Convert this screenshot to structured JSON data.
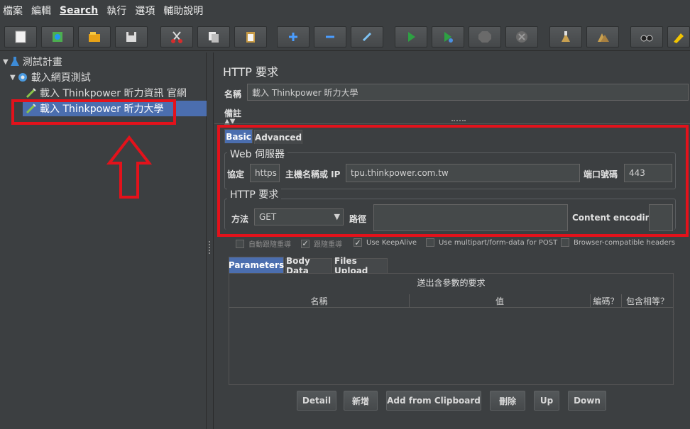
{
  "menu": [
    "檔案",
    "編輯",
    "Search",
    "執行",
    "選項",
    "輔助說明"
  ],
  "toolbar_icons": [
    "new-icon",
    "templates-icon",
    "open-icon",
    "save-icon",
    "cut-icon",
    "copy-icon",
    "paste-icon",
    "expand-icon",
    "collapse-icon",
    "toggle-icon",
    "start-icon",
    "start-no-pause-icon",
    "stop-icon",
    "shutdown-icon",
    "clear-icon",
    "clear-all-icon",
    "search-icon",
    "reset-search-icon"
  ],
  "tree": {
    "plan": "測試計畫",
    "threadgroup": "載入網頁測試",
    "item1": "載入 Thinkpower 昕力資訊 官網",
    "item2": "載入 Thinkpower 昕力大學"
  },
  "panel": {
    "title": "HTTP 要求",
    "name_label": "名稱",
    "name_value": "載入 Thinkpower 昕力大學",
    "comment_label": "備註"
  },
  "tabs": [
    "Basic",
    "Advanced"
  ],
  "web_server": {
    "title": "Web 伺服器",
    "protocol_label": "協定",
    "protocol_value": "https",
    "host_label": "主機名稱或 IP",
    "host_value": "tpu.thinkpower.com.tw",
    "port_label": "端口號碼",
    "port_value": "443"
  },
  "http_request": {
    "title": "HTTP 要求",
    "method_label": "方法",
    "method_value": "GET",
    "path_label": "路徑",
    "path_value": "",
    "encoding_label": "Content encoding:"
  },
  "checkboxes": [
    {
      "label": "自動跟隨重導",
      "checked": false
    },
    {
      "label": "跟隨重導",
      "checked": true
    },
    {
      "label": "Use KeepAlive",
      "checked": true
    },
    {
      "label": "Use multipart/form-data for POST",
      "checked": false
    },
    {
      "label": "Browser-compatible headers",
      "checked": false
    }
  ],
  "param_tabs": [
    "Parameters",
    "Body Data",
    "Files Upload"
  ],
  "table": {
    "caption": "送出含參數的要求",
    "columns": [
      "名稱",
      "值",
      "編碼？",
      "包含相等？"
    ]
  },
  "buttons": [
    "Detail",
    "新增",
    "Add from Clipboard",
    "刪除",
    "Up",
    "Down"
  ],
  "colors": {
    "highlight": "#e3121b",
    "selection": "#4b6eaf",
    "background": "#3c3f41"
  }
}
